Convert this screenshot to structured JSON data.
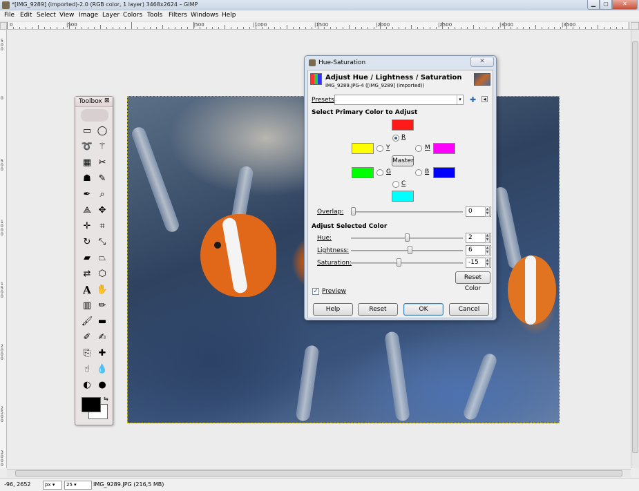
{
  "window": {
    "title": "*[IMG_9289] (imported)-2.0 (RGB color, 1 layer) 3468x2624 – GIMP",
    "minimize_glyph": "▁",
    "maximize_glyph": "▢",
    "close_glyph": "✕"
  },
  "menubar": {
    "items": [
      "File",
      "Edit",
      "Select",
      "View",
      "Image",
      "Layer",
      "Colors",
      "Tools",
      "Filters",
      "Windows",
      "Help"
    ]
  },
  "rulers": {
    "horizontal_labels": [
      "0",
      "|500",
      "|500",
      "|1000",
      "|1500",
      "|2000",
      "|2500",
      "|3000",
      "|3500"
    ],
    "vertical_labels": [
      "500",
      "0",
      "500",
      "1000",
      "1500",
      "2000",
      "2500",
      "3000"
    ]
  },
  "toolbox": {
    "title": "Toolbox",
    "close_glyph": "⊠",
    "tools": [
      "rect-select",
      "ellipse-select",
      "free-select",
      "fuzzy-select",
      "select-by-color",
      "scissors-select",
      "foreground-select",
      "paths",
      "color-picker",
      "zoom",
      "measure",
      "move",
      "align",
      "crop",
      "rotate",
      "scale",
      "shear",
      "perspective",
      "flip",
      "cage-transform",
      "text",
      "heal",
      "blend",
      "pencil",
      "paintbrush",
      "eraser",
      "airbrush",
      "ink",
      "clone",
      "perspective-clone",
      "smudge",
      "blur-sharpen",
      "dodge-burn",
      "bucket-fill"
    ],
    "text_tool_glyph": "A"
  },
  "dialog": {
    "window_title": "Hue-Saturation",
    "close_glyph": "✕",
    "heading": "Adjust Hue / Lightness / Saturation",
    "subheading": "IMG_9289.JPG-4 ([IMG_9289] (imported))",
    "presets_label": "Presets:",
    "presets_value": "",
    "select_primary_label": "Select Primary Color to Adjust",
    "primaries": {
      "R": {
        "label": "R",
        "color": "#ff1a1a",
        "selected": true
      },
      "Y": {
        "label": "Y",
        "color": "#ffff00",
        "selected": false
      },
      "M": {
        "label": "M",
        "color": "#ff00ff",
        "selected": false
      },
      "G": {
        "label": "G",
        "color": "#00ff00",
        "selected": false
      },
      "B": {
        "label": "B",
        "color": "#0000ff",
        "selected": false
      },
      "C": {
        "label": "C",
        "color": "#00ffff",
        "selected": false
      }
    },
    "master_label": "Master",
    "overlap": {
      "label": "Overlap:",
      "value": "0",
      "fraction": 0.0
    },
    "adjust_selected_label": "Adjust Selected Color",
    "hue": {
      "label": "Hue:",
      "value": "2",
      "fraction": 0.505
    },
    "lightness": {
      "label": "Lightness:",
      "value": "6",
      "fraction": 0.53
    },
    "saturation": {
      "label": "Saturation:",
      "value": "-15",
      "fraction": 0.425
    },
    "reset_color_label": "Reset Color",
    "preview_label": "Preview",
    "preview_checked": true,
    "buttons": {
      "help": "Help",
      "reset": "Reset",
      "ok": "OK",
      "cancel": "Cancel"
    }
  },
  "statusbar": {
    "coords": "-96, 2652",
    "unit": "px",
    "zoom": "25",
    "file_info": "IMG_9289.JPG (216,5 MB)"
  }
}
